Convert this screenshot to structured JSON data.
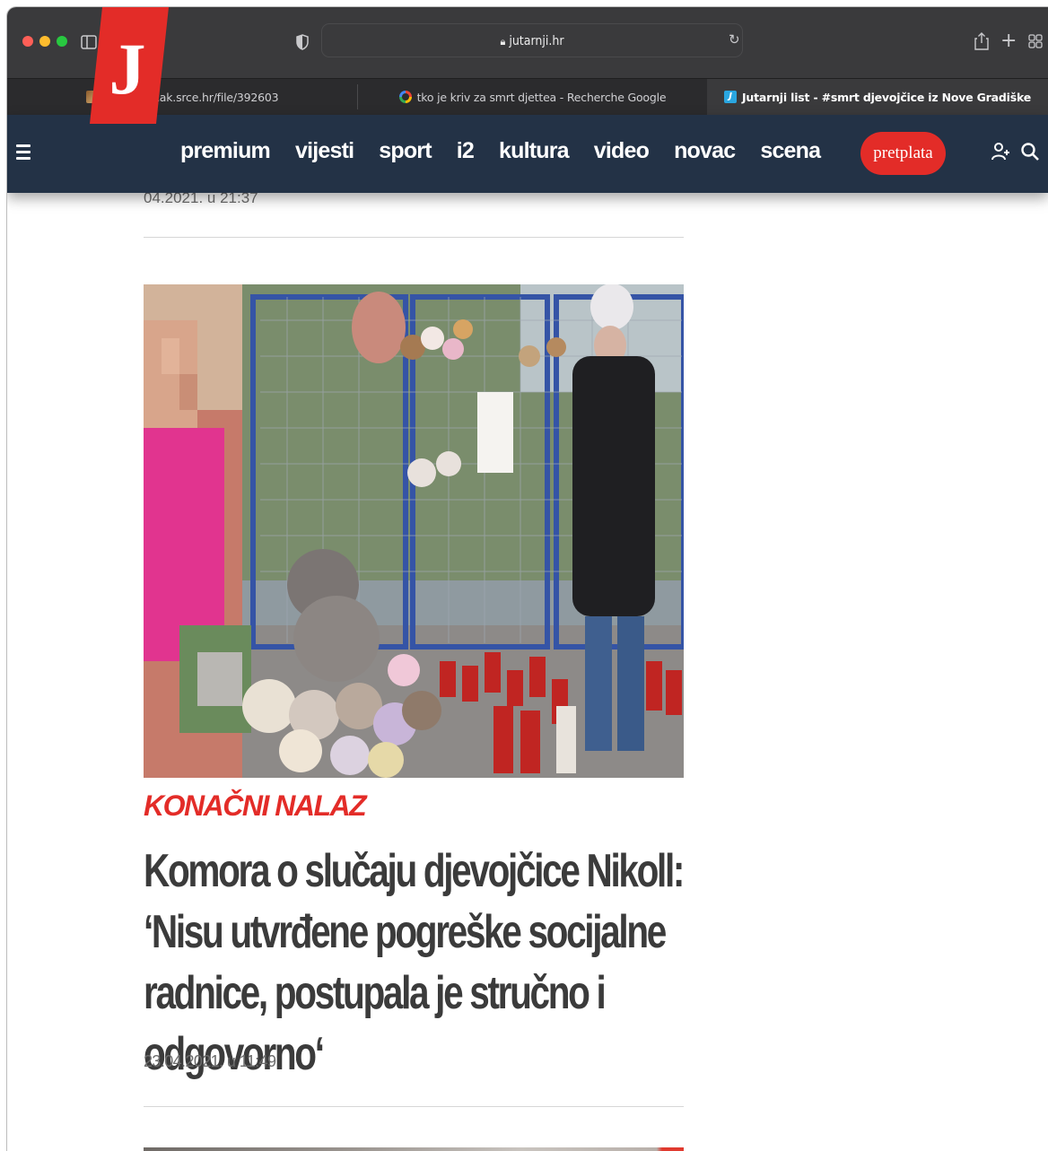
{
  "browser": {
    "url": "jutarnji.hr",
    "tabs": [
      {
        "label": "https://hrcak.srce.hr/file/392603",
        "icon": "hrcak-favicon"
      },
      {
        "label": "tko je kriv za smrt djettea - Recherche Google",
        "icon": "google-favicon"
      },
      {
        "label": "Jutarnji list - #smrt djevojčice iz Nove Gradiške",
        "icon": "jutarnji-favicon",
        "active": true
      }
    ]
  },
  "site": {
    "logo": "J",
    "nav": [
      "premium",
      "vijesti",
      "sport",
      "i2",
      "kultura",
      "video",
      "novac",
      "scena"
    ],
    "subscribe_label": "pretplata"
  },
  "article_prev": {
    "date": "04.2021. u 21:37"
  },
  "article": {
    "kicker": "KONAČNI NALAZ",
    "title": "Komora o slučaju djevojčice Nikoll: ‘Nisu utvrđene pogreške socijalne radnice, postupala je stručno i odgovorno‘",
    "date": "23.04.2021. u 11:49",
    "image_alt": "memorial with teddy bears and candles at fence"
  },
  "colors": {
    "brand_red": "#e32c28",
    "header_bg": "#233246",
    "title_gray": "#3b3b3b"
  }
}
